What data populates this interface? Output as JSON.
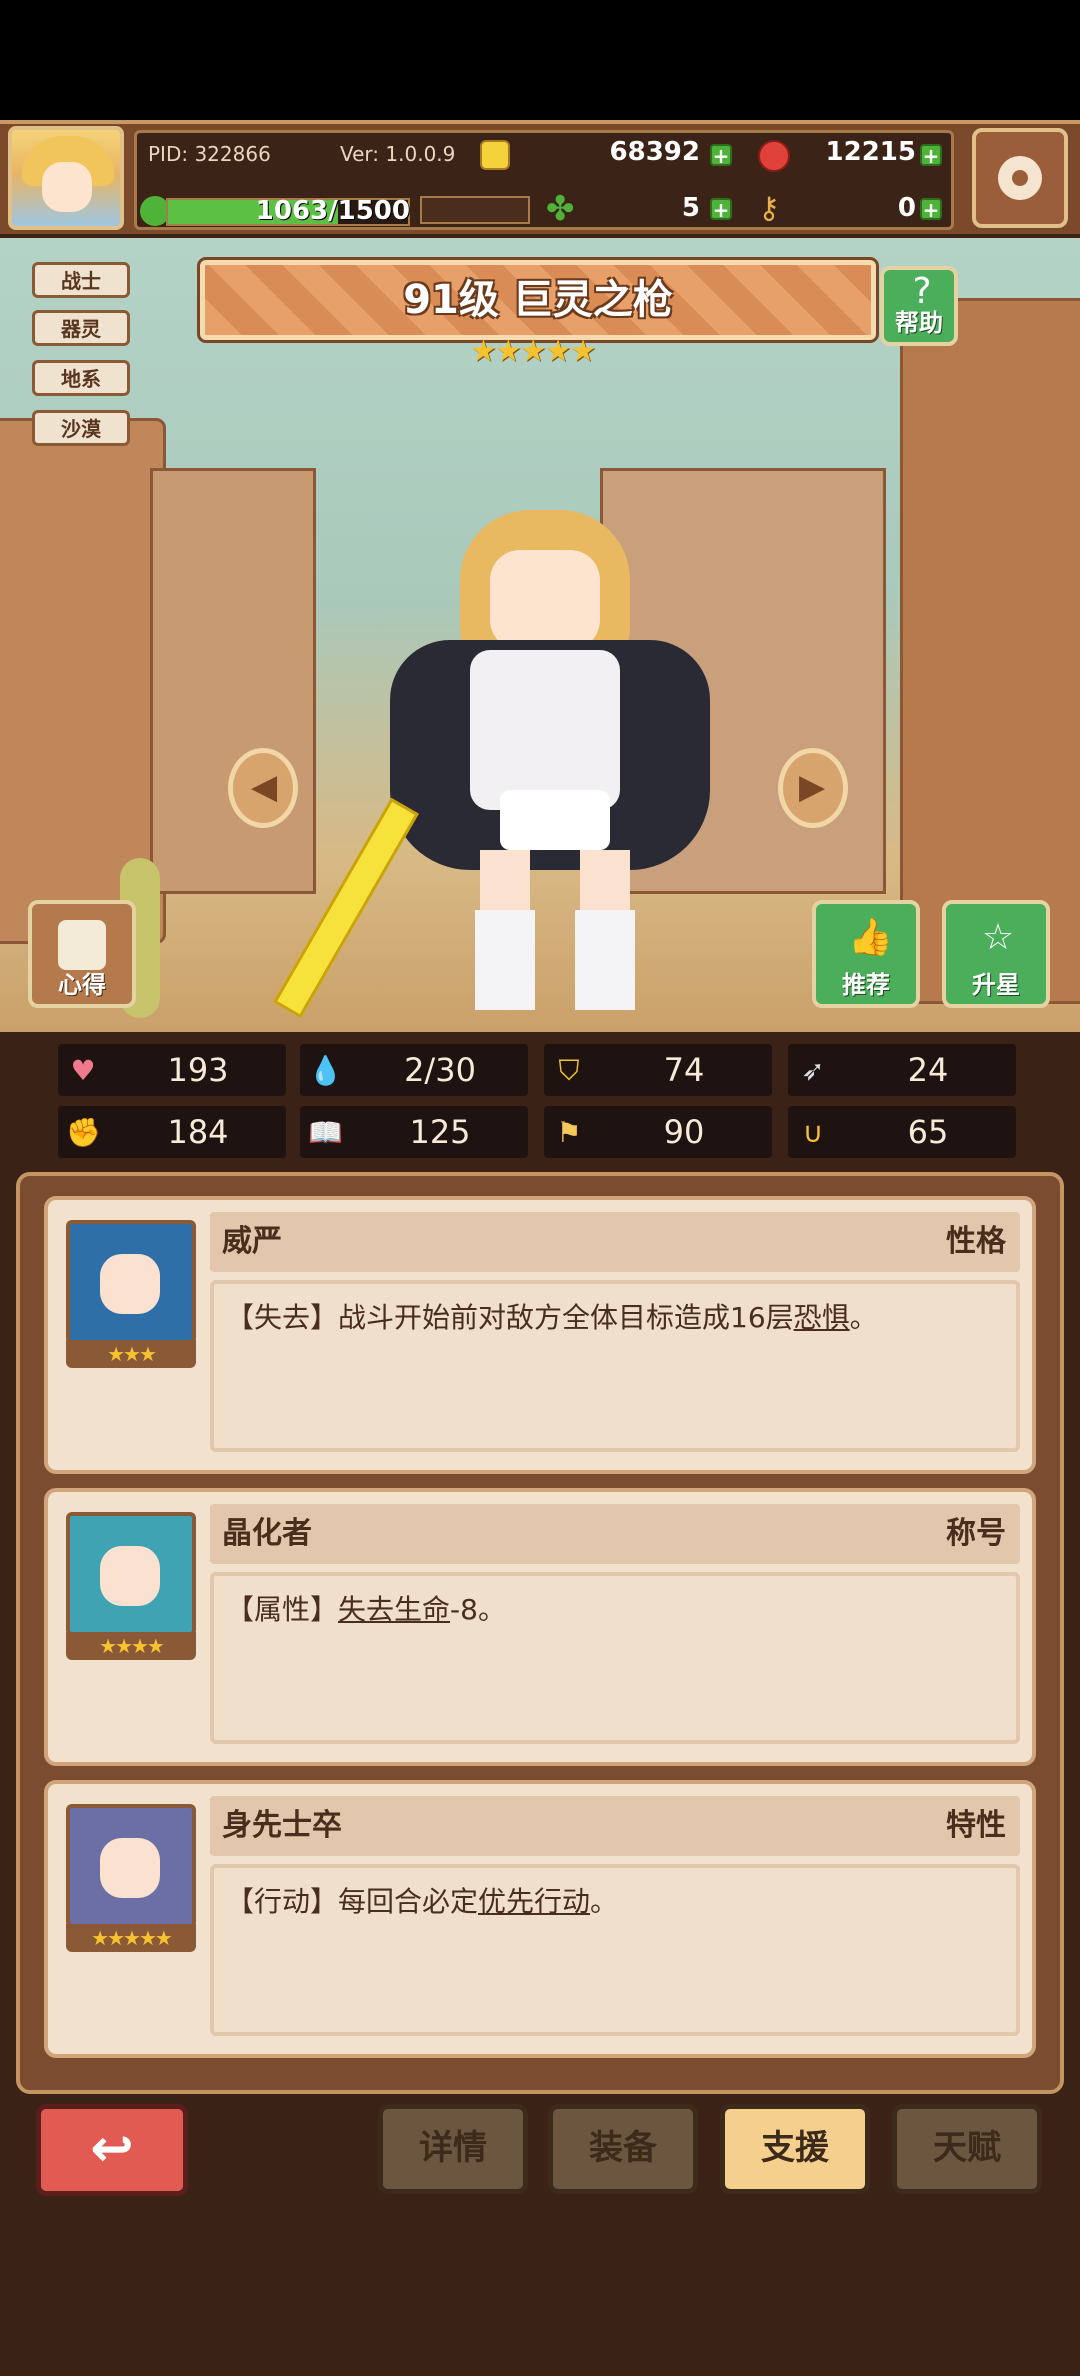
{
  "header": {
    "pid": "PID: 322866",
    "version": "Ver: 1.0.0.9",
    "gold": "68392",
    "gems": "12215",
    "exp": "1063/1500",
    "exp_fraction": 0.709,
    "clover": "5",
    "key": "0"
  },
  "hero": {
    "title": "91级  巨灵之枪",
    "stars": "★★★★★",
    "tags": [
      "战士",
      "器灵",
      "地系",
      "沙漠"
    ],
    "help_label": "帮助",
    "xinde_label": "心得",
    "recommend_label": "推荐",
    "upgrade_label": "升星"
  },
  "stats": [
    {
      "icon": "heart-icon",
      "value": "193"
    },
    {
      "icon": "water-drop-icon",
      "value": "2/30"
    },
    {
      "icon": "shield-icon",
      "value": "74"
    },
    {
      "icon": "wing-icon",
      "value": "24"
    },
    {
      "icon": "fist-icon",
      "value": "184"
    },
    {
      "icon": "book-icon",
      "value": "125"
    },
    {
      "icon": "flag-icon",
      "value": "90"
    },
    {
      "icon": "horseshoe-icon",
      "value": "65"
    }
  ],
  "cards": [
    {
      "name": "威严",
      "type": "性格",
      "stars": "★★★",
      "text_prefix": "【失去】战斗开始前对敌方全体目标造成16层",
      "text_link": "恐惧",
      "text_suffix": "。",
      "portrait_color": "#2f6fa8"
    },
    {
      "name": "晶化者",
      "type": "称号",
      "stars": "★★★★",
      "text_prefix": "【属性】",
      "text_link": "失去生命",
      "text_suffix": "-8。",
      "portrait_color": "#3fa3b4"
    },
    {
      "name": "身先士卒",
      "type": "特性",
      "stars": "★★★★★",
      "text_prefix": "【行动】每回合必定",
      "text_link": "优先行动",
      "text_suffix": "。",
      "portrait_color": "#6b6fa5"
    }
  ],
  "bottom": {
    "back_icon": "back-arrow-icon",
    "tabs": [
      "详情",
      "装备",
      "支援",
      "天赋"
    ],
    "active_tab": "支援"
  }
}
